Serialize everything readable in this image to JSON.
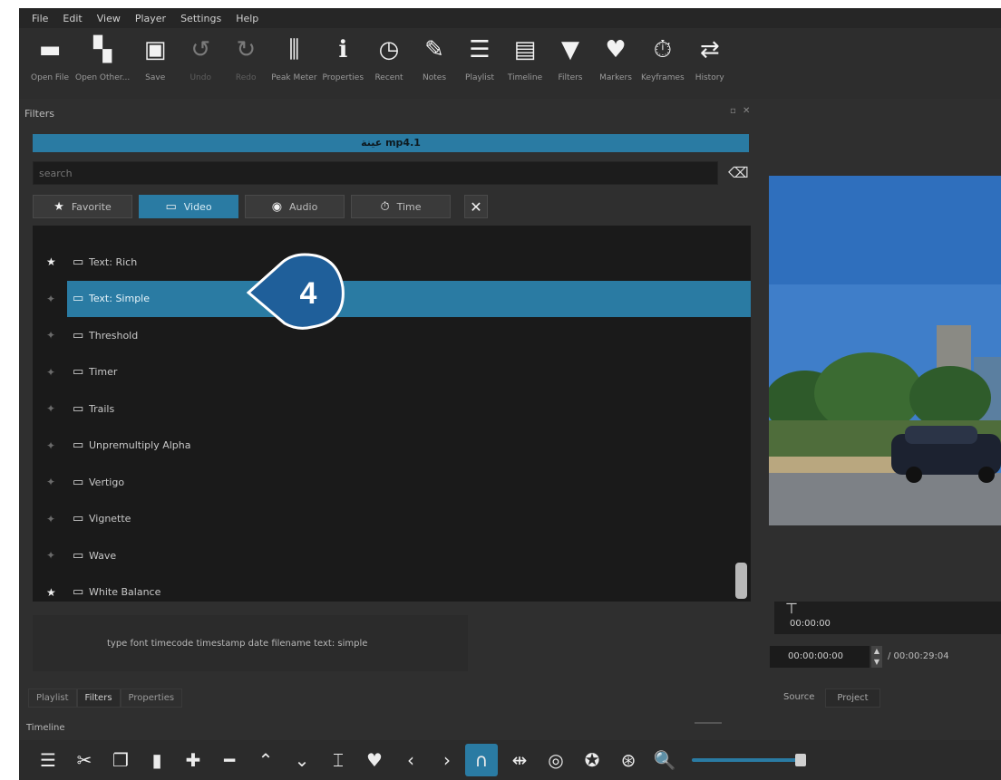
{
  "menu": [
    "File",
    "Edit",
    "View",
    "Player",
    "Settings",
    "Help"
  ],
  "toolbar": [
    {
      "label": "Open File",
      "icon": "folder-icon",
      "glyph": "▬"
    },
    {
      "label": "Open Other...",
      "icon": "open-other-icon",
      "glyph": "▚"
    },
    {
      "label": "Save",
      "icon": "save-icon",
      "glyph": "▣"
    },
    {
      "label": "Undo",
      "icon": "undo-icon",
      "glyph": "↺",
      "dim": true
    },
    {
      "label": "Redo",
      "icon": "redo-icon",
      "glyph": "↻",
      "dim": true
    },
    {
      "label": "Peak Meter",
      "icon": "peak-meter-icon",
      "glyph": "⫼"
    },
    {
      "label": "Properties",
      "icon": "info-icon",
      "glyph": "ℹ"
    },
    {
      "label": "Recent",
      "icon": "clock-icon",
      "glyph": "◷"
    },
    {
      "label": "Notes",
      "icon": "notes-icon",
      "glyph": "✎"
    },
    {
      "label": "Playlist",
      "icon": "playlist-icon",
      "glyph": "☰"
    },
    {
      "label": "Timeline",
      "icon": "timeline-icon",
      "glyph": "▤"
    },
    {
      "label": "Filters",
      "icon": "filter-icon",
      "glyph": "▼"
    },
    {
      "label": "Markers",
      "icon": "marker-icon",
      "glyph": "♥"
    },
    {
      "label": "Keyframes",
      "icon": "keyframes-icon",
      "glyph": "⏱"
    },
    {
      "label": "History",
      "icon": "history-icon",
      "glyph": "⇄"
    }
  ],
  "filters_panel": {
    "title": "Filters",
    "window_controls": "▫ ✕",
    "clip_name": "عينة mp4.1",
    "search_placeholder": "search",
    "tabs": [
      {
        "label": "Favorite",
        "glyph": "★"
      },
      {
        "label": "Video",
        "glyph": "▭"
      },
      {
        "label": "Audio",
        "glyph": "◉"
      },
      {
        "label": "Time",
        "glyph": "⏱"
      }
    ],
    "close_glyph": "✕",
    "items": [
      {
        "name": "Text: Rich",
        "fav": true
      },
      {
        "name": "Text: Simple",
        "fav": false
      },
      {
        "name": "Threshold",
        "fav": false
      },
      {
        "name": "Timer",
        "fav": false
      },
      {
        "name": "Trails",
        "fav": false
      },
      {
        "name": "Unpremultiply Alpha",
        "fav": false
      },
      {
        "name": "Vertigo",
        "fav": false
      },
      {
        "name": "Vignette",
        "fav": false
      },
      {
        "name": "Wave",
        "fav": false
      },
      {
        "name": "White Balance",
        "fav": true
      }
    ],
    "selected_index": 1,
    "description": "type font timecode timestamp date filename text: simple"
  },
  "callout": {
    "number": "4"
  },
  "bottom_tabs": [
    "Playlist",
    "Filters",
    "Properties"
  ],
  "right_tabs": [
    "Source",
    "Project"
  ],
  "timeline_label": "Timeline",
  "preview": {
    "ruler_time": "00:00:00",
    "timecode": "00:00:00:00",
    "total": "/ 00:00:29:04"
  },
  "bottom_toolbar": [
    {
      "icon": "menu-icon",
      "glyph": "☰"
    },
    {
      "icon": "cut-icon",
      "glyph": "✂"
    },
    {
      "icon": "copy-icon",
      "glyph": "❐"
    },
    {
      "icon": "paste-icon",
      "glyph": "▮"
    },
    {
      "icon": "append-icon",
      "glyph": "✚"
    },
    {
      "icon": "remove-icon",
      "glyph": "━"
    },
    {
      "icon": "lift-icon",
      "glyph": "⌃"
    },
    {
      "icon": "overwrite-icon",
      "glyph": "⌄"
    },
    {
      "icon": "split-icon",
      "glyph": "⌶"
    },
    {
      "icon": "marker-icon",
      "glyph": "♥"
    },
    {
      "icon": "prev-marker-icon",
      "glyph": "‹"
    },
    {
      "icon": "next-marker-icon",
      "glyph": "›"
    },
    {
      "icon": "snap-icon",
      "glyph": "∩",
      "active": true
    },
    {
      "icon": "scrub-icon",
      "glyph": "⇹"
    },
    {
      "icon": "ripple-icon",
      "glyph": "◎"
    },
    {
      "icon": "ripple-all-icon",
      "glyph": "✪"
    },
    {
      "icon": "ripple-markers-icon",
      "glyph": "⊛"
    },
    {
      "icon": "zoom-out-icon",
      "glyph": "🔍"
    }
  ],
  "colors": {
    "accent": "#2a7ba3",
    "background": "#2f2f2f",
    "list_bg": "#1a1a1a"
  }
}
